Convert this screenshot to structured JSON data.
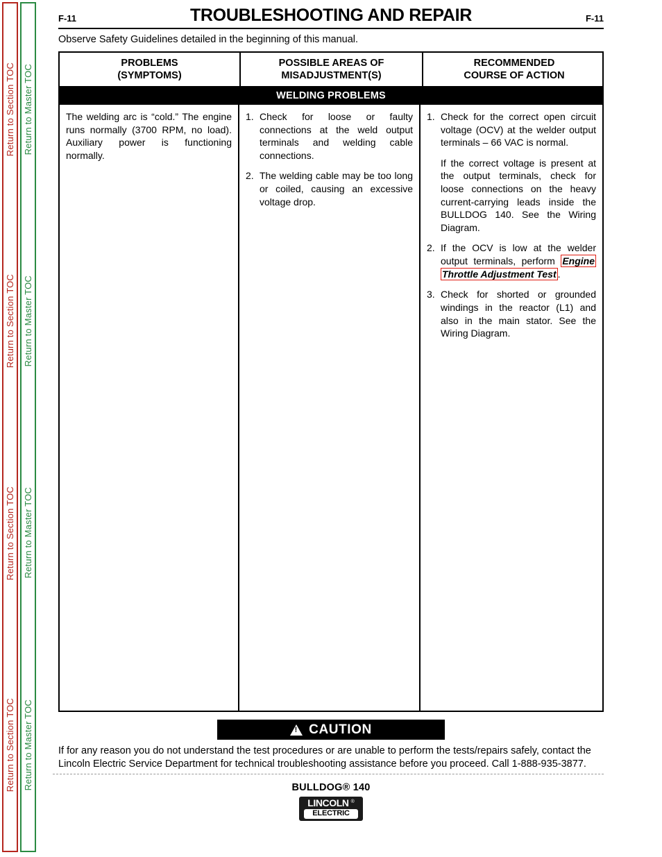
{
  "sidebar": {
    "section_toc": {
      "label": "Return to Section TOC",
      "color": "#b5261e",
      "repeat": 4
    },
    "master_toc": {
      "label": "Return to Master TOC",
      "color": "#2a8a42",
      "repeat": 4
    }
  },
  "header": {
    "folio_left": "F-11",
    "title": "TROUBLESHOOTING AND REPAIR",
    "folio_right": "F-11"
  },
  "intro": "Observe Safety Guidelines detailed in the beginning of this manual.",
  "table": {
    "columns": [
      {
        "line1": "PROBLEMS",
        "line2": "(SYMPTOMS)"
      },
      {
        "line1": "POSSIBLE AREAS OF",
        "line2": "MISADJUSTMENT(S)"
      },
      {
        "line1": "RECOMMENDED",
        "line2": "COURSE OF ACTION"
      }
    ],
    "band_label": "WELDING PROBLEMS",
    "row": {
      "symptom": "The welding arc is “cold.”  The engine runs normally (3700 RPM, no load).  Auxiliary power is functioning normally.",
      "possible_areas": [
        {
          "num": "1.",
          "text": "Check for loose or faulty connections at the weld output terminals and welding cable connections."
        },
        {
          "num": "2.",
          "text": "The welding cable may be too long or coiled, causing an excessive voltage drop."
        }
      ],
      "recommended": {
        "item1_num": "1.",
        "item1_text": "Check for the correct open circuit voltage (OCV) at the welder output terminals – 66 VAC is normal.",
        "item1_sub": "If the correct voltage is present at the output terminals, check for loose connections on the heavy current-carrying leads inside the BULLDOG 140.  See the Wiring Diagram.",
        "item2_num": "2.",
        "item2_lead": "If the OCV is low at the welder output terminals, perform ",
        "item2_link": "Engine Throttle Adjustment Test",
        "item2_tail": ".",
        "item3_num": "3.",
        "item3_text": "Check for shorted or grounded windings in the reactor (L1) and also in the main stator.  See the Wiring Diagram."
      }
    }
  },
  "caution": {
    "icon": "warning-triangle-icon",
    "banner_label": "CAUTION",
    "body": "If for any reason you do not understand the test procedures or are unable to perform the tests/repairs safely, contact the Lincoln Electric Service Department for technical troubleshooting assistance before you proceed. Call 1-888-935-3877."
  },
  "footer": {
    "model": "BULLDOG® 140",
    "logo_primary": "LINCOLN",
    "logo_registered": "®",
    "logo_secondary": "ELECTRIC"
  }
}
